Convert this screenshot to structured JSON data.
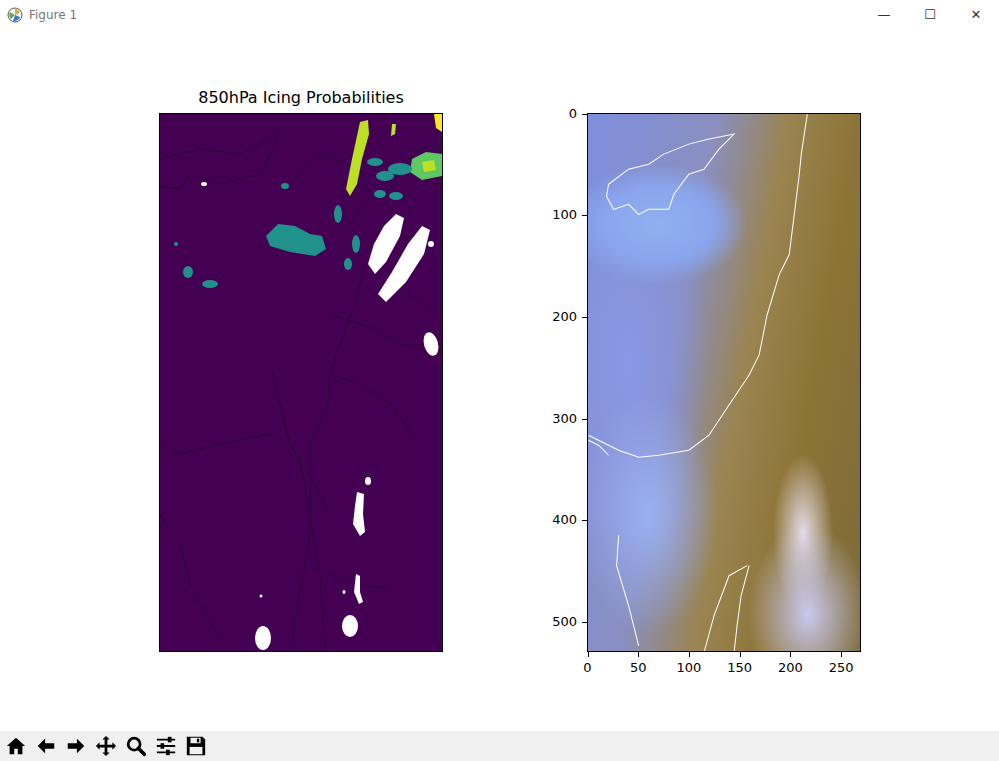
{
  "window": {
    "title": "Figure 1",
    "controls": [
      "—",
      "☐",
      "✕"
    ]
  },
  "left_plot": {
    "title": "850hPa Icing Probabilities"
  },
  "right_plot": {
    "y_ticks": [
      "0",
      "100",
      "200",
      "300",
      "400",
      "500"
    ],
    "x_ticks": [
      "0",
      "50",
      "100",
      "150",
      "200",
      "250"
    ]
  }
}
